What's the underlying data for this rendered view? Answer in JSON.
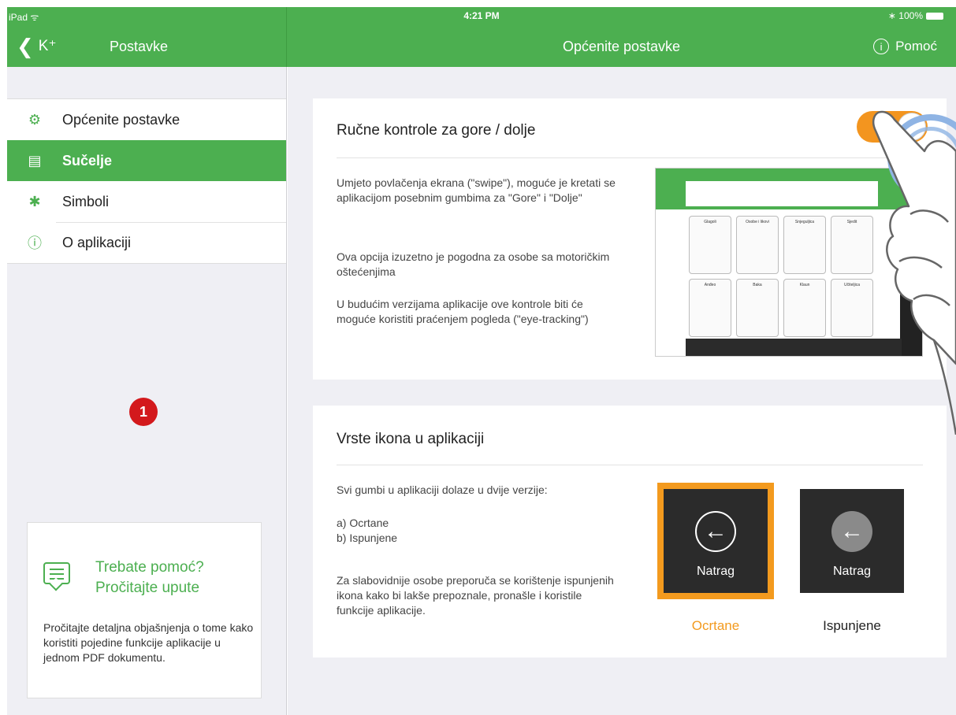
{
  "status": {
    "carrier": "iPad ᯤ",
    "time": "4:21 PM",
    "battery": "∗ 100%"
  },
  "nav": {
    "back_label": "K⁺",
    "sidebar_title": "Postavke",
    "main_title": "Općenite postavke",
    "help_label": "Pomoć"
  },
  "sidebar": {
    "items": [
      {
        "label": "Općenite postavke",
        "icon": "gear-icon",
        "active": false
      },
      {
        "label": "Sučelje",
        "icon": "interface-icon",
        "active": true
      },
      {
        "label": "Simboli",
        "icon": "symbol-figure-icon",
        "active": false
      },
      {
        "label": "O aplikaciji",
        "icon": "info-icon",
        "active": false
      }
    ],
    "badge": "1",
    "help_box": {
      "heading_line1": "Trebate pomoć?",
      "heading_line2": "Pročitajte upute",
      "text": "Pročitajte detaljna objašnjenja o tome kako koristiti pojedine funkcije aplikacije u jednom PDF dokumentu."
    }
  },
  "card_controls": {
    "title": "Ručne kontrole za gore / dolje",
    "toggle_on": true,
    "p1": "Umjeto povlačenja ekrana (\"swipe\"), moguće je kretati se aplikacijom posebnim gumbima za \"Gore\" i \"Dolje\"",
    "p2": "Ova opcija izuzetno je pogodna za osobe sa motoričkim oštećenjima",
    "p3": "U budućim verzijama aplikacije ove kontrole biti će moguće koristiti praćenjem pogleda (\"eye-tracking\")",
    "preview_cells": [
      "Glagoli",
      "Osobe i likovi",
      "Snjeguljica",
      "Sjedit",
      "Anđeo",
      "Baka",
      "Klaun",
      "Učiteljica"
    ]
  },
  "card_icons": {
    "title": "Vrste ikona u aplikaciji",
    "p1": "Svi gumbi u aplikaciji dolaze u dvije verzije:",
    "p2a": "a) Ocrtane",
    "p2b": "b) Ispunjene",
    "p3": "Za slabovidnije osobe preporuča se korištenje ispunjenih ikona kako bi lakše prepoznale, pronašle i koristile funkcije aplikacije.",
    "tile_label": "Natrag",
    "option_outlined": "Ocrtane",
    "option_filled": "Ispunjene",
    "selected": "Ocrtane"
  },
  "colors": {
    "brand_green": "#4caf50",
    "accent_orange": "#f39a1e",
    "badge_red": "#d3191c"
  }
}
